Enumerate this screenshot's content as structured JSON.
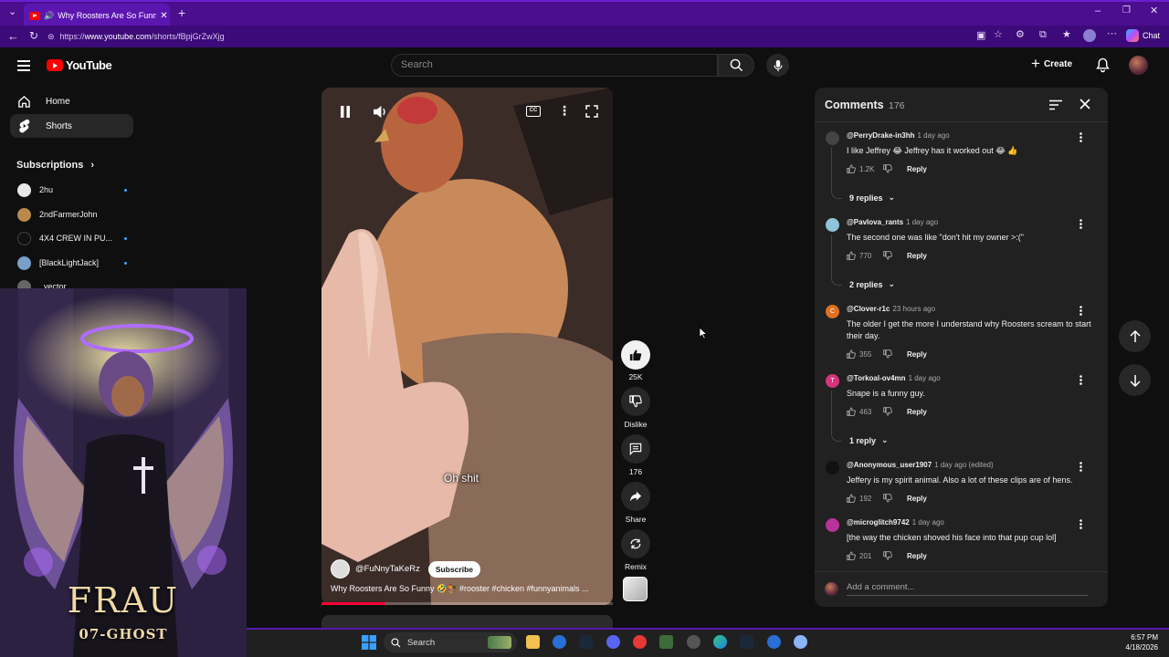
{
  "browser": {
    "tab_title": "Why Roosters Are So Funny 🤣",
    "url_prefix": "https://",
    "url_host": "www.youtube.com",
    "url_path": "/shorts/fBpjGrZwXjg",
    "chat_label": "Chat",
    "accent": "#4a0e8f"
  },
  "header": {
    "logo_text": "YouTube",
    "search_placeholder": "Search",
    "create_label": "Create"
  },
  "sidebar": {
    "items": [
      {
        "label": "Home",
        "icon": "home-icon"
      },
      {
        "label": "Shorts",
        "icon": "shorts-icon",
        "active": true
      }
    ],
    "subscriptions_label": "Subscriptions",
    "subscriptions": [
      {
        "name": "2hu",
        "new": true,
        "color": "#e8e8e8"
      },
      {
        "name": "2ndFarmerJohn",
        "new": false,
        "color": "#b98b4a"
      },
      {
        "name": "4X4 CREW IN PU...",
        "new": true,
        "color": "#111111"
      },
      {
        "name": "[BlackLightJack]",
        "new": true,
        "color": "#7aa0c8"
      },
      {
        "name": "_vector",
        "new": false,
        "color": "#666666"
      }
    ]
  },
  "overlay_art": {
    "title": "FRAU",
    "subtitle": "07-GHOST"
  },
  "video": {
    "caption": "Oh shit",
    "channel": "@FuNnyTaKeRz",
    "subscribe_label": "Subscribe",
    "title": "Why Roosters Are So Funny 🤣🐓 #rooster #chicken #funnyanimals ...",
    "progress": 0.22
  },
  "actions": {
    "likes": "25K",
    "dislike_label": "Dislike",
    "comments": "176",
    "share_label": "Share",
    "remix_label": "Remix"
  },
  "comments_panel": {
    "title": "Comments",
    "count": "176",
    "add_placeholder": "Add a comment...",
    "reply_label": "Reply",
    "comments": [
      {
        "handle": "@PerryDrake-in3hh",
        "time": "1 day ago",
        "text": "I like Jeffrey 😂 Jeffrey has it worked out 😂 👍",
        "likes": "1.2K",
        "avatar_color": "#444444",
        "initial": ""
      },
      {
        "handle": "@Pavlova_rants",
        "time": "1 day ago",
        "text": "The second one was like \"don't hit my owner >:(\"",
        "likes": "770",
        "avatar_color": "#8fc3d8",
        "initial": ""
      },
      {
        "handle": "@Clover-r1c",
        "time": "23 hours ago",
        "text": "The older I get the more I understand why Roosters scream to start their day.",
        "likes": "355",
        "avatar_color": "#e0701f",
        "initial": "C"
      },
      {
        "handle": "@Torkoal-ov4mn",
        "time": "1 day ago",
        "text": "Snape is a funny guy.",
        "likes": "463",
        "avatar_color": "#d6337a",
        "initial": "T"
      },
      {
        "handle": "@Anonymous_user1907",
        "time": "1 day ago (edited)",
        "text": "Jeffery is my spirit animal. Also a lot of these clips are of hens.",
        "likes": "192",
        "avatar_color": "#111111",
        "initial": ""
      },
      {
        "handle": "@microglitch9742",
        "time": "1 day ago",
        "text": "[the way the chicken shoved his face into that pup cup lol]",
        "likes": "201",
        "avatar_color": "#b8329a",
        "initial": ""
      }
    ],
    "replies": [
      "9 replies",
      "2 replies",
      "1 reply"
    ]
  },
  "taskbar": {
    "search_label": "Search",
    "time": "6:57 PM",
    "date": "4/18/2026"
  }
}
